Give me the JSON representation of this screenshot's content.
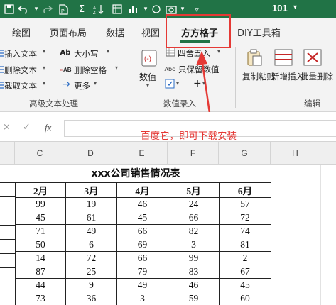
{
  "titlebar": {
    "filename": "101",
    "quick_access": [
      "save-icon",
      "undo-icon",
      "redo-icon",
      "autosum-icon",
      "sort-icon",
      "format-painter-icon",
      "camera-icon",
      "customize-icon"
    ]
  },
  "tabs": [
    "绘图",
    "页面布局",
    "数据",
    "视图",
    "方方格子",
    "DIY工具箱"
  ],
  "active_tab": "方方格子",
  "ribbon": {
    "text_group": {
      "items_left": [
        "插入文本",
        "删除文本",
        "截取文本"
      ],
      "items_right": [
        "大小写",
        "删除空格",
        "更多"
      ],
      "label": "高级文本处理"
    },
    "number_group": {
      "numeric_label": "数值",
      "round_label": "四舍五入",
      "keep_label": "只保留数值",
      "label": "数值录入"
    },
    "edit_group": {
      "copy_paste": "复制粘贴",
      "insert": "新增插入",
      "delete": "批量删除",
      "label": "编辑"
    }
  },
  "formula_bar": {
    "cancel_icon": "×",
    "confirm_icon": "✓",
    "fx_label": "fx",
    "value": ""
  },
  "annotation": {
    "text": "百度它，即可下载安装",
    "color": "#e53935"
  },
  "columns": [
    "C",
    "D",
    "E",
    "F",
    "G",
    "H"
  ],
  "sheet": {
    "title": "xxx公司销售情况表",
    "headers": [
      "2月",
      "3月",
      "4月",
      "5月",
      "6月"
    ],
    "rows": [
      [
        "99",
        "19",
        "46",
        "24",
        "57"
      ],
      [
        "45",
        "61",
        "45",
        "66",
        "72"
      ],
      [
        "71",
        "49",
        "66",
        "82",
        "74"
      ],
      [
        "50",
        "6",
        "69",
        "3",
        "81"
      ],
      [
        "14",
        "72",
        "66",
        "99",
        "2"
      ],
      [
        "87",
        "25",
        "79",
        "83",
        "67"
      ],
      [
        "44",
        "9",
        "49",
        "46",
        "45"
      ],
      [
        "73",
        "36",
        "3",
        "59",
        "60"
      ]
    ]
  },
  "colors": {
    "accent": "#217346",
    "annotation": "#e53935"
  }
}
